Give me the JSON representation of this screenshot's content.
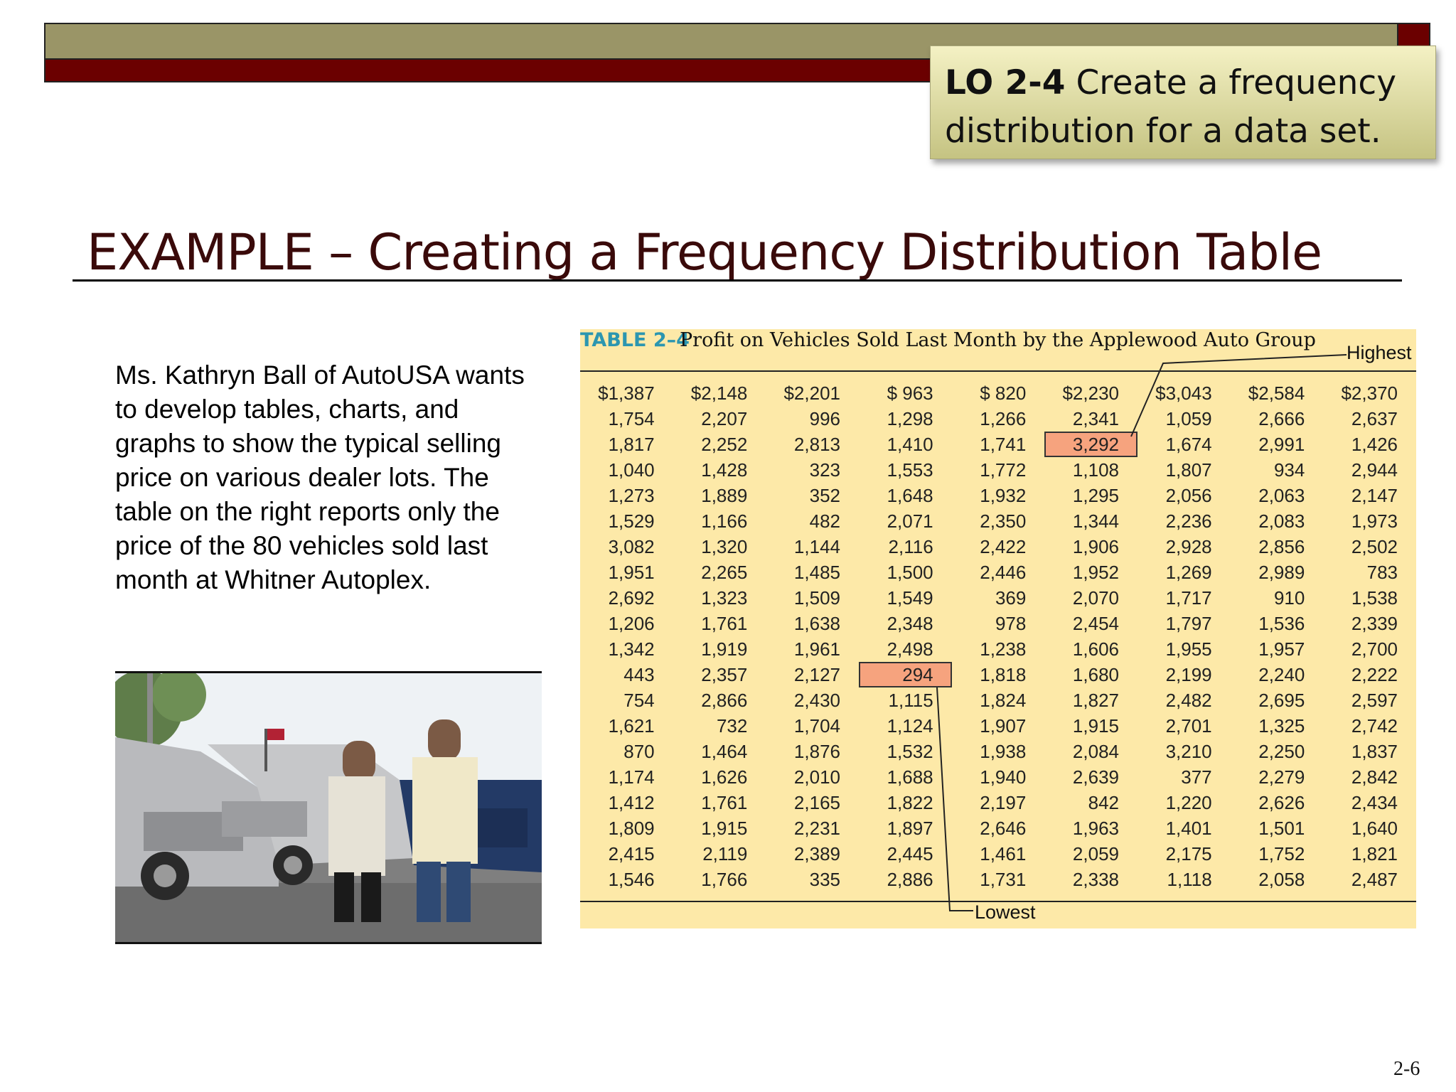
{
  "objective": {
    "code": "LO 2-4",
    "text": "Create a frequency distribution for a data set."
  },
  "title": "EXAMPLE – Creating a Frequency Distribution Table",
  "description": "Ms. Kathryn Ball of AutoUSA wants to develop tables, charts, and graphs to show the typical selling price on various dealer lots. The table on the right reports only the price of the 80 vehicles sold last month at Whitner Autoplex.",
  "table": {
    "label": "TABLE 2–4",
    "title": "Profit on Vehicles Sold Last Month by the Applewood Auto Group",
    "highest_label": "Highest",
    "lowest_label": "Lowest",
    "highlight_color": "#f6a37e",
    "rows": [
      [
        "$1,387",
        "$2,148",
        "$2,201",
        "$ 963",
        "$ 820",
        "$2,230",
        "$3,043",
        "$2,584",
        "$2,370"
      ],
      [
        "1,754",
        "2,207",
        "996",
        "1,298",
        "1,266",
        "2,341",
        "1,059",
        "2,666",
        "2,637"
      ],
      [
        "1,817",
        "2,252",
        "2,813",
        "1,410",
        "1,741",
        "3,292",
        "1,674",
        "2,991",
        "1,426"
      ],
      [
        "1,040",
        "1,428",
        "323",
        "1,553",
        "1,772",
        "1,108",
        "1,807",
        "934",
        "2,944"
      ],
      [
        "1,273",
        "1,889",
        "352",
        "1,648",
        "1,932",
        "1,295",
        "2,056",
        "2,063",
        "2,147"
      ],
      [
        "1,529",
        "1,166",
        "482",
        "2,071",
        "2,350",
        "1,344",
        "2,236",
        "2,083",
        "1,973"
      ],
      [
        "3,082",
        "1,320",
        "1,144",
        "2,116",
        "2,422",
        "1,906",
        "2,928",
        "2,856",
        "2,502"
      ],
      [
        "1,951",
        "2,265",
        "1,485",
        "1,500",
        "2,446",
        "1,952",
        "1,269",
        "2,989",
        "783"
      ],
      [
        "2,692",
        "1,323",
        "1,509",
        "1,549",
        "369",
        "2,070",
        "1,717",
        "910",
        "1,538"
      ],
      [
        "1,206",
        "1,761",
        "1,638",
        "2,348",
        "978",
        "2,454",
        "1,797",
        "1,536",
        "2,339"
      ],
      [
        "1,342",
        "1,919",
        "1,961",
        "2,498",
        "1,238",
        "1,606",
        "1,955",
        "1,957",
        "2,700"
      ],
      [
        "443",
        "2,357",
        "2,127",
        "294",
        "1,818",
        "1,680",
        "2,199",
        "2,240",
        "2,222"
      ],
      [
        "754",
        "2,866",
        "2,430",
        "1,115",
        "1,824",
        "1,827",
        "2,482",
        "2,695",
        "2,597"
      ],
      [
        "1,621",
        "732",
        "1,704",
        "1,124",
        "1,907",
        "1,915",
        "2,701",
        "1,325",
        "2,742"
      ],
      [
        "870",
        "1,464",
        "1,876",
        "1,532",
        "1,938",
        "2,084",
        "3,210",
        "2,250",
        "1,837"
      ],
      [
        "1,174",
        "1,626",
        "2,010",
        "1,688",
        "1,940",
        "2,639",
        "377",
        "2,279",
        "2,842"
      ],
      [
        "1,412",
        "1,761",
        "2,165",
        "1,822",
        "2,197",
        "842",
        "1,220",
        "2,626",
        "2,434"
      ],
      [
        "1,809",
        "1,915",
        "2,231",
        "1,897",
        "2,646",
        "1,963",
        "1,401",
        "1,501",
        "1,640"
      ],
      [
        "2,415",
        "2,119",
        "2,389",
        "2,445",
        "1,461",
        "2,059",
        "2,175",
        "1,752",
        "1,821"
      ],
      [
        "1,546",
        "1,766",
        "335",
        "2,886",
        "1,731",
        "2,338",
        "1,118",
        "2,058",
        "2,487"
      ]
    ],
    "highest_cell": {
      "row": 2,
      "col": 5
    },
    "lowest_cell": {
      "row": 11,
      "col": 3
    }
  },
  "page_number": "2-6"
}
